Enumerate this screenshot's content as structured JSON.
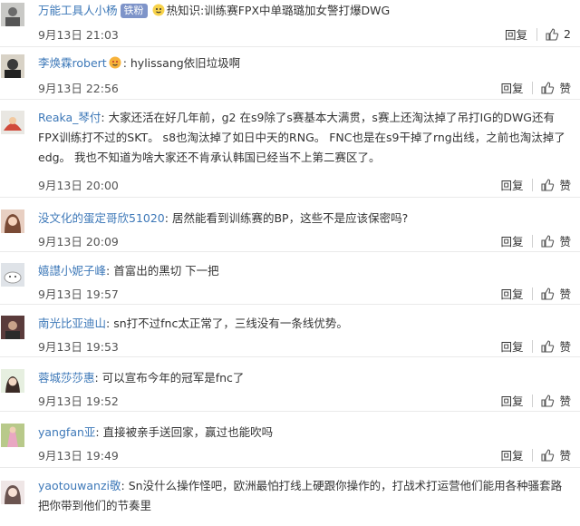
{
  "labels": {
    "reply": "回复",
    "like": "赞"
  },
  "comments": [
    {
      "user": "万能工具人小杨",
      "badge": "铁粉",
      "text": "热知识:训练赛FPX中单璐璐加女警打爆DWG",
      "time": "9月13日 21:03",
      "likes": "2"
    },
    {
      "user": "李焕霖robert",
      "text": "hylissang依旧垃圾啊",
      "time": "9月13日 22:56"
    },
    {
      "user": "Reaka_琴付",
      "text": "大家还活在好几年前，g2 在s9除了s赛基本大满贯，s赛上还淘汰掉了吊打IG的DWG还有FPX训练打不过的SKT。 s8也淘汰掉了如日中天的RNG。 FNC也是在s9干掉了rng出线，之前也淘汰掉了edg。 我也不知道为啥大家还不肯承认韩国已经当不上第二赛区了。",
      "time": "9月13日 20:00"
    },
    {
      "user": "没文化的蛋定哥欣51020",
      "text": "居然能看到训练赛的BP，这些不是应该保密吗?",
      "time": "9月13日 20:09"
    },
    {
      "user": "嬉譿小妮子峰",
      "text": "首富出的黑切 下一把",
      "time": "9月13日 19:57"
    },
    {
      "user": "南光比亚迪山",
      "text": "sn打不过fnc太正常了，三线没有一条线优势。",
      "time": "9月13日 19:53"
    },
    {
      "user": "蓉城莎莎惠",
      "text": "可以宣布今年的冠军是fnc了",
      "time": "9月13日 19:52"
    },
    {
      "user": "yangfan亚",
      "text": "直接被亲手送回家，赢过也能吹吗",
      "time": "9月13日 19:49"
    },
    {
      "user": "yaotouwanzi敬",
      "text": "Sn没什么操作怪吧，欧洲最怕打线上硬跟你操作的，打战术打运营他们能用各种骚套路把你带到他们的节奏里"
    }
  ],
  "colors": {
    "username": "#3d78b8",
    "text": "#333333",
    "badge": "#7e94c9",
    "divider": "#eaeaea"
  },
  "icons": {
    "like": "thumbs-up-icon",
    "emoji": "smiley-emoji-icon"
  }
}
